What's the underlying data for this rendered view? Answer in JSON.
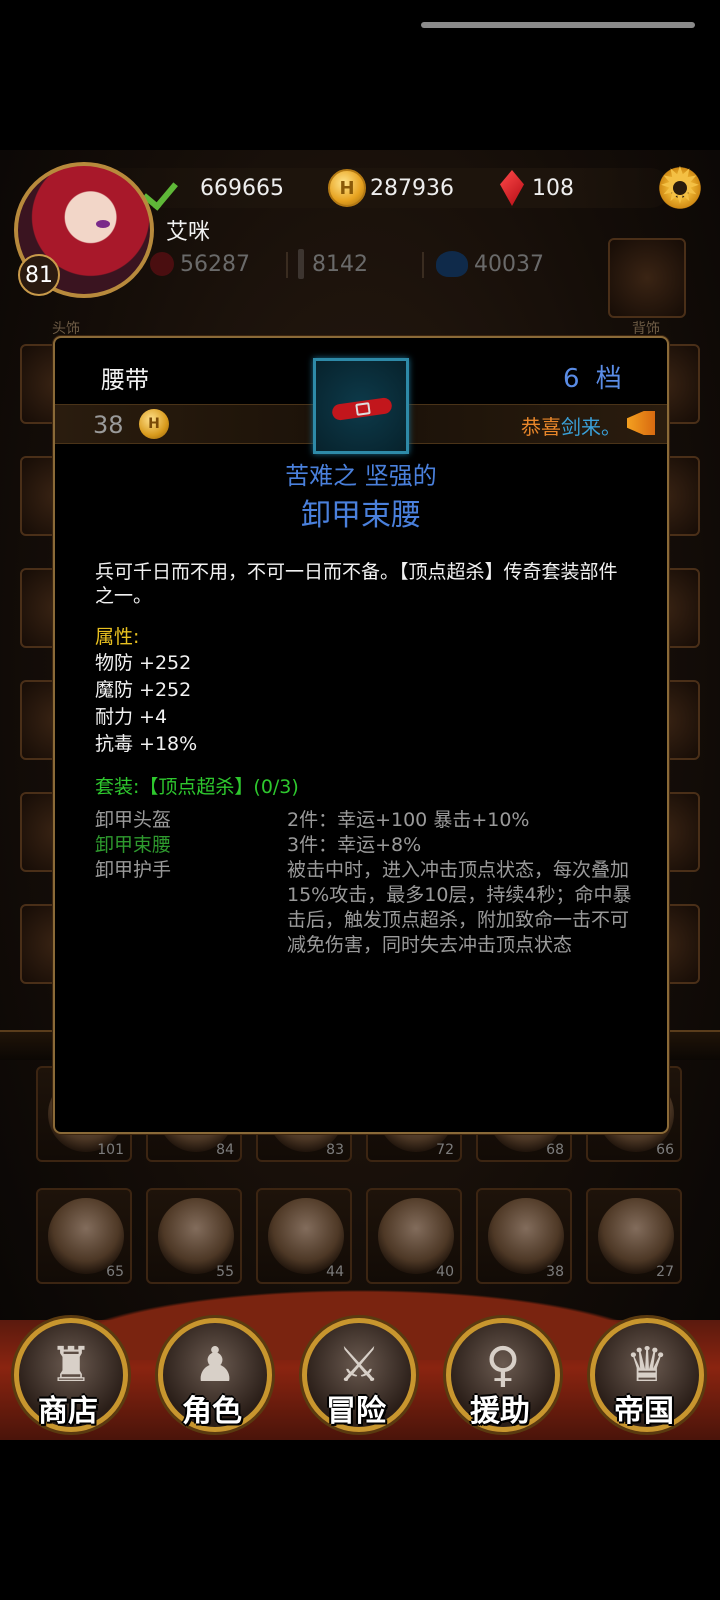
{
  "header": {
    "stats": {
      "power": "669665",
      "gold": "287936",
      "gems": "108"
    },
    "player": {
      "name": "艾咪",
      "level": "81"
    },
    "substats": {
      "attack": "56287",
      "weapon": "8142",
      "mana": "40037"
    }
  },
  "equip_slots": {
    "left_label": "头饰",
    "right_label": "背饰"
  },
  "hero_grid": {
    "row1": [
      "101",
      "84",
      "83",
      "72",
      "68",
      "66"
    ],
    "row2": [
      "65",
      "55",
      "44",
      "40",
      "38",
      "27"
    ]
  },
  "item_popup": {
    "type": "腰带",
    "grade": "6 档",
    "price": "38",
    "announce_a": "恭喜",
    "announce_b": "剑来。",
    "prefix": "苦难之 坚强的",
    "name": "卸甲束腰",
    "description": "兵可千日而不用，不可一日而不备。【顶点超杀】传奇套装部件之一。",
    "attr_title": "属性:",
    "attributes": [
      "物防 +252",
      "魔防 +252",
      "耐力 +4",
      "抗毒 +18%"
    ],
    "set_title": "套装:【顶点超杀】(0/3)",
    "set_pieces": [
      "卸甲头盔",
      "卸甲束腰",
      "卸甲护手"
    ],
    "set_bonuses": [
      "2件：幸运+100 暴击+10%",
      "3件：幸运+8%",
      "被击中时，进入冲击顶点状态，每次叠加15%攻击，最多10层，持续4秒；命中暴击后，触发顶点超杀，附加致命一击不可减免伤害，同时失去冲击顶点状态"
    ]
  },
  "nav": [
    "商店",
    "角色",
    "冒险",
    "援助",
    "帝国"
  ],
  "colors": {
    "accent_blue": "#4a80dc",
    "set_green": "#2ec82e",
    "attr_yellow": "#e8c020",
    "gold_frame": "#c8962e"
  }
}
